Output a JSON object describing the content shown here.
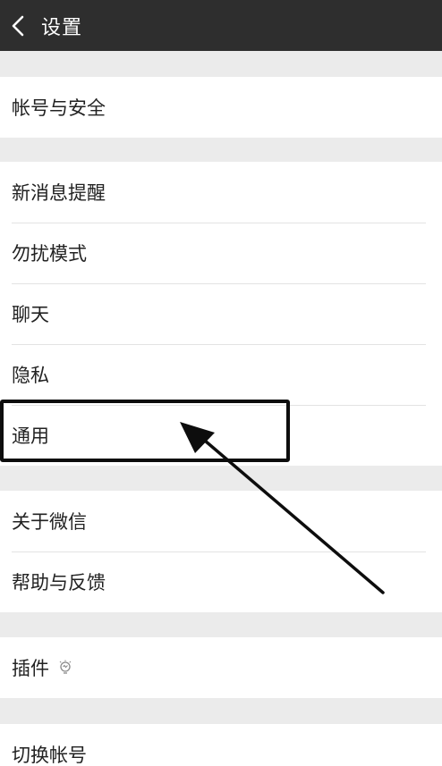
{
  "header": {
    "title": "设置",
    "back_icon": "chevron-left-icon"
  },
  "groups": [
    {
      "items": [
        {
          "label": "帐号与安全"
        }
      ]
    },
    {
      "items": [
        {
          "label": "新消息提醒"
        },
        {
          "label": "勿扰模式"
        },
        {
          "label": "聊天"
        },
        {
          "label": "隐私"
        },
        {
          "label": "通用"
        }
      ]
    },
    {
      "items": [
        {
          "label": "关于微信"
        },
        {
          "label": "帮助与反馈"
        }
      ]
    },
    {
      "items": [
        {
          "label": "插件",
          "badge_icon": "bulb-icon"
        }
      ]
    },
    {
      "items": [
        {
          "label": "切换帐号"
        }
      ]
    }
  ],
  "colors": {
    "topbar": "#2e2e2e",
    "background": "#ebebeb",
    "row_bg": "#ffffff",
    "annotation": "#0d0d0d"
  }
}
